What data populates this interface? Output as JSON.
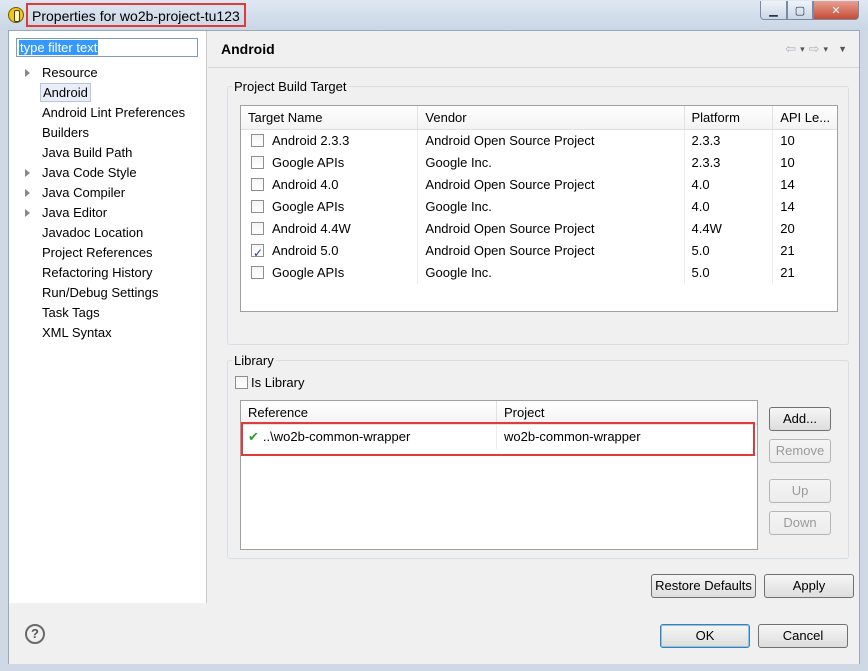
{
  "window": {
    "title": "Properties for wo2b-project-tu123",
    "min_glyph": "▁",
    "max_glyph": "▢",
    "close_glyph": "✕"
  },
  "sidebar": {
    "filter_text": "type filter text",
    "items": [
      {
        "label": "Resource",
        "expandable": true
      },
      {
        "label": "Android",
        "expandable": false,
        "selected": true
      },
      {
        "label": "Android Lint Preferences",
        "expandable": false
      },
      {
        "label": "Builders",
        "expandable": false
      },
      {
        "label": "Java Build Path",
        "expandable": false
      },
      {
        "label": "Java Code Style",
        "expandable": true
      },
      {
        "label": "Java Compiler",
        "expandable": true
      },
      {
        "label": "Java Editor",
        "expandable": true
      },
      {
        "label": "Javadoc Location",
        "expandable": false
      },
      {
        "label": "Project References",
        "expandable": false
      },
      {
        "label": "Refactoring History",
        "expandable": false
      },
      {
        "label": "Run/Debug Settings",
        "expandable": false
      },
      {
        "label": "Task Tags",
        "expandable": false
      },
      {
        "label": "XML Syntax",
        "expandable": false
      }
    ]
  },
  "page": {
    "title": "Android",
    "nav": {
      "back": "⇦",
      "forward": "⇨",
      "dropdown": "▾",
      "menu": "▼"
    }
  },
  "build_target": {
    "legend": "Project Build Target",
    "columns": [
      "Target Name",
      "Vendor",
      "Platform",
      "API Le..."
    ],
    "rows": [
      {
        "name": "Android 2.3.3",
        "vendor": "Android Open Source Project",
        "platform": "2.3.3",
        "api": "10",
        "checked": false
      },
      {
        "name": "Google APIs",
        "vendor": "Google Inc.",
        "platform": "2.3.3",
        "api": "10",
        "checked": false
      },
      {
        "name": "Android 4.0",
        "vendor": "Android Open Source Project",
        "platform": "4.0",
        "api": "14",
        "checked": false
      },
      {
        "name": "Google APIs",
        "vendor": "Google Inc.",
        "platform": "4.0",
        "api": "14",
        "checked": false
      },
      {
        "name": "Android 4.4W",
        "vendor": "Android Open Source Project",
        "platform": "4.4W",
        "api": "20",
        "checked": false
      },
      {
        "name": "Android 5.0",
        "vendor": "Android Open Source Project",
        "platform": "5.0",
        "api": "21",
        "checked": true
      },
      {
        "name": "Google APIs",
        "vendor": "Google Inc.",
        "platform": "5.0",
        "api": "21",
        "checked": false
      }
    ]
  },
  "library": {
    "legend": "Library",
    "is_library_label": "Is Library",
    "is_library_checked": false,
    "columns": [
      "Reference",
      "Project"
    ],
    "rows": [
      {
        "reference": "..\\wo2b-common-wrapper",
        "project": "wo2b-common-wrapper"
      }
    ],
    "buttons": {
      "add": "Add...",
      "remove": "Remove",
      "up": "Up",
      "down": "Down"
    }
  },
  "buttons": {
    "restore_defaults": "Restore Defaults",
    "apply": "Apply",
    "ok": "OK",
    "cancel": "Cancel",
    "help": "?"
  },
  "colors": {
    "highlight": "#e03b3b",
    "check_ok": "#2aa12a"
  }
}
